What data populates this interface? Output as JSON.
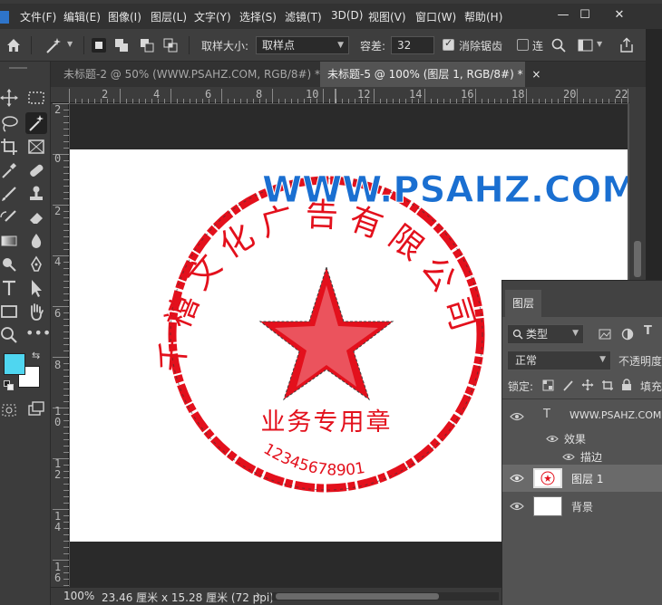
{
  "menu": {
    "items": [
      "文件(F)",
      "编辑(E)",
      "图像(I)",
      "图层(L)",
      "文字(Y)",
      "选择(S)",
      "滤镜(T)",
      "3D(D)",
      "视图(V)",
      "窗口(W)",
      "帮助(H)"
    ],
    "win_min": "—",
    "win_max": "☐",
    "win_close": "✕"
  },
  "options": {
    "sample_size_label": "取样大小:",
    "sample_size_value": "取样点",
    "tolerance_label": "容差:",
    "tolerance_value": "32",
    "antialias_label": "消除锯齿",
    "antialias_checked": true,
    "contiguous_label": "连",
    "contiguous_checked": false
  },
  "tabs": [
    {
      "label": "未标题-2 @ 50% (WWW.PSAHZ.COM, RGB/8#) *",
      "close": "×"
    },
    {
      "label": "未标题-5 @ 100% (图层 1, RGB/8#) *",
      "close": "×"
    }
  ],
  "ruler": {
    "h_labels": [
      "2",
      "4",
      "6",
      "8",
      "10",
      "12",
      "14",
      "16",
      "18",
      "20",
      "22"
    ],
    "v_labels": [
      "2",
      "0",
      "2",
      "4",
      "6",
      "8",
      "1\n0",
      "1\n2",
      "1\n4",
      "1\n6"
    ]
  },
  "stamp": {
    "company": "千禧文化广告有限公司",
    "company_chars": [
      "千",
      "禧",
      "文",
      "化",
      "广",
      "告",
      "有",
      "限",
      "公",
      "司"
    ],
    "subtitle": "业务专用章",
    "serial": "12345678901",
    "watermark": "WWW.PSAHZ.COM",
    "color": "#e3101c",
    "watermark_color": "#1a6fd1"
  },
  "status": {
    "zoom": "100%",
    "doc_size": "23.46 厘米 x 15.28 厘米 (72 ppi)",
    "arrow": "›"
  },
  "layers_panel": {
    "tab_label": "图层",
    "filter_label": "类型",
    "blend_mode": "正常",
    "opacity_label": "不透明度",
    "lock_label": "锁定:",
    "fill_label": "填充",
    "layers": [
      {
        "name": "WWW.PSAHZ.COM",
        "kind": "text",
        "visible": true
      },
      {
        "name": "效果",
        "kind": "effects",
        "visible": true
      },
      {
        "name": "描边",
        "kind": "effect",
        "visible": true
      },
      {
        "name": "图层 1",
        "kind": "pixel",
        "visible": true,
        "selected": true
      },
      {
        "name": "背景",
        "kind": "background",
        "visible": true
      }
    ],
    "text_layer_glyph": "T"
  },
  "colors": {
    "foreground": "#4fd6f0",
    "background": "#ffffff",
    "app_bg": "#535353"
  }
}
